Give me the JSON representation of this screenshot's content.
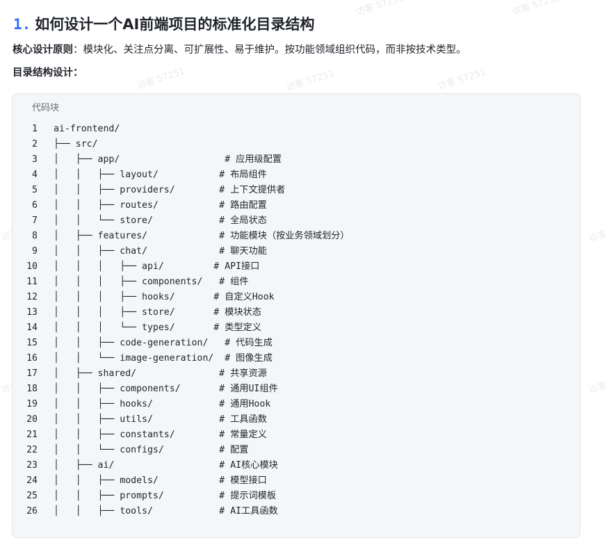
{
  "heading": {
    "number": "1.",
    "title": "如何设计一个AI前端项目的标准化目录结构"
  },
  "principle": {
    "label": "核心设计原则",
    "text": "：模块化、关注点分离、可扩展性、易于维护。按功能领域组织代码，而非按技术类型。"
  },
  "structure_label": "目录结构设计：",
  "code_block": {
    "caption": "代码块",
    "lines": [
      {
        "n": "1",
        "code": "ai-frontend/"
      },
      {
        "n": "2",
        "code": "├── src/"
      },
      {
        "n": "3",
        "code": "│   ├── app/                   # 应用级配置"
      },
      {
        "n": "4",
        "code": "│   │   ├── layout/           # 布局组件"
      },
      {
        "n": "5",
        "code": "│   │   ├── providers/        # 上下文提供者"
      },
      {
        "n": "6",
        "code": "│   │   ├── routes/           # 路由配置"
      },
      {
        "n": "7",
        "code": "│   │   └── store/            # 全局状态"
      },
      {
        "n": "8",
        "code": "│   ├── features/             # 功能模块（按业务领域划分）"
      },
      {
        "n": "9",
        "code": "│   │   ├── chat/             # 聊天功能"
      },
      {
        "n": "10",
        "code": "│   │   │   ├── api/         # API接口"
      },
      {
        "n": "11",
        "code": "│   │   │   ├── components/   # 组件"
      },
      {
        "n": "12",
        "code": "│   │   │   ├── hooks/       # 自定义Hook"
      },
      {
        "n": "13",
        "code": "│   │   │   ├── store/       # 模块状态"
      },
      {
        "n": "14",
        "code": "│   │   │   └── types/       # 类型定义"
      },
      {
        "n": "15",
        "code": "│   │   ├── code-generation/   # 代码生成"
      },
      {
        "n": "16",
        "code": "│   │   └── image-generation/  # 图像生成"
      },
      {
        "n": "17",
        "code": "│   ├── shared/               # 共享资源"
      },
      {
        "n": "18",
        "code": "│   │   ├── components/       # 通用UI组件"
      },
      {
        "n": "19",
        "code": "│   │   ├── hooks/            # 通用Hook"
      },
      {
        "n": "20",
        "code": "│   │   ├── utils/            # 工具函数"
      },
      {
        "n": "21",
        "code": "│   │   ├── constants/        # 常量定义"
      },
      {
        "n": "22",
        "code": "│   │   └── configs/          # 配置"
      },
      {
        "n": "23",
        "code": "│   ├── ai/                   # AI核心模块"
      },
      {
        "n": "24",
        "code": "│   │   ├── models/           # 模型接口"
      },
      {
        "n": "25",
        "code": "│   │   ├── prompts/          # 提示词模板"
      },
      {
        "n": "26",
        "code": "│   │   ├── tools/            # AI工具函数"
      }
    ]
  },
  "watermark": "访客 57251"
}
